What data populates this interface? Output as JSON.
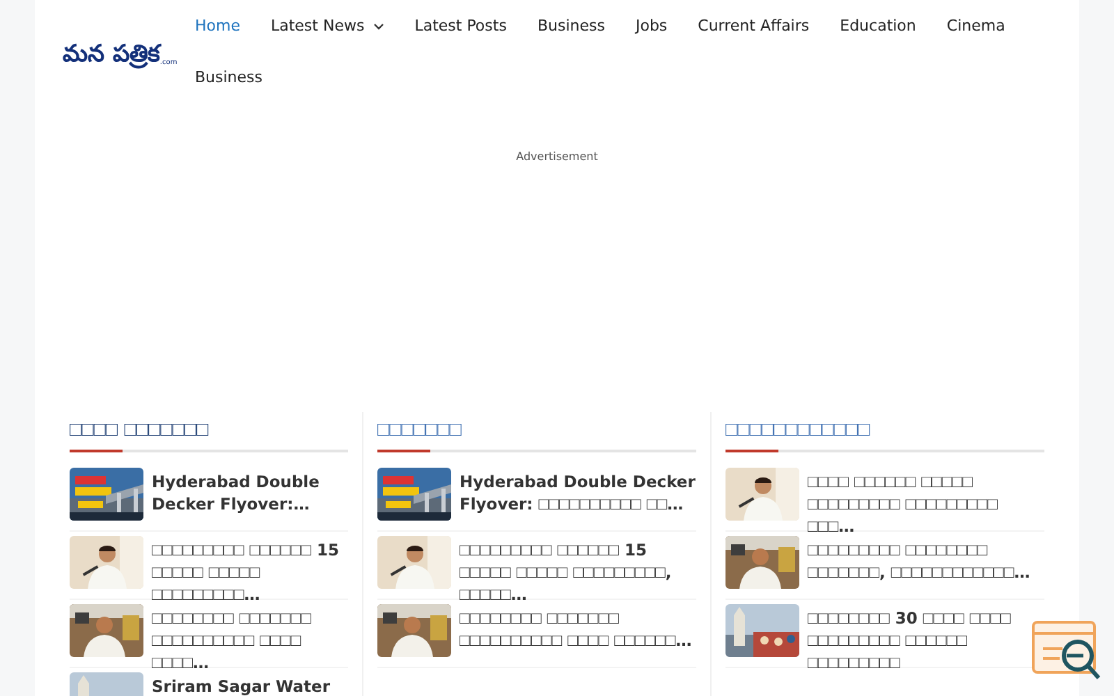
{
  "logo": {
    "name": "మన పత్రిక",
    "suffix": ".com"
  },
  "nav": [
    {
      "label": "Home",
      "selected": true,
      "dropdown": false
    },
    {
      "label": "Latest News",
      "selected": false,
      "dropdown": true
    },
    {
      "label": "Latest Posts",
      "selected": false,
      "dropdown": false
    },
    {
      "label": "Business",
      "selected": false,
      "dropdown": false
    },
    {
      "label": "Jobs",
      "selected": false,
      "dropdown": false
    },
    {
      "label": "Current Affairs",
      "selected": false,
      "dropdown": false
    },
    {
      "label": "Education",
      "selected": false,
      "dropdown": false
    },
    {
      "label": "Cinema",
      "selected": false,
      "dropdown": false
    },
    {
      "label": "Business",
      "selected": false,
      "dropdown": false
    }
  ],
  "advertisement": "Advertisement",
  "sections": [
    {
      "title": "□□□□ □□□□□□□",
      "posts": [
        {
          "title": "Hyderabad Double Decker Flyover:…"
        },
        {
          "title": "□□□□□□□□□ □□□□□□ 15 □□□□□ □□□□□ □□□□□□□□□…"
        },
        {
          "title": "□□□□□□□□ □□□□□□□ □□□□□□□□□□ □□□□ □□□□…"
        },
        {
          "title": "Sriram Sagar Water"
        }
      ]
    },
    {
      "title": "□□□□□□□",
      "posts": [
        {
          "title": "Hyderabad Double Decker Flyover: □□□□□□□□□□ □□…"
        },
        {
          "title": "□□□□□□□□□ □□□□□□ 15 □□□□□ □□□□□ □□□□□□□□□, □□□□□…"
        },
        {
          "title": "□□□□□□□□ □□□□□□□ □□□□□□□□□□ □□□□ □□□□□□…"
        }
      ]
    },
    {
      "title": "□□□□□□□□□□□□",
      "posts": [
        {
          "title": "□□□□ □□□□□□ □□□□□ □□□□□□□□□ □□□□□□□□□ □□□…"
        },
        {
          "title": "□□□□□□□□□ □□□□□□□□ □□□□□□□, □□□□□□□□□□□□…"
        },
        {
          "title": "□□□□□□□□ 30 □□□□ □□□□ □□□□□□□□□ □□□□□□ □□□□□□□□□"
        }
      ]
    }
  ]
}
